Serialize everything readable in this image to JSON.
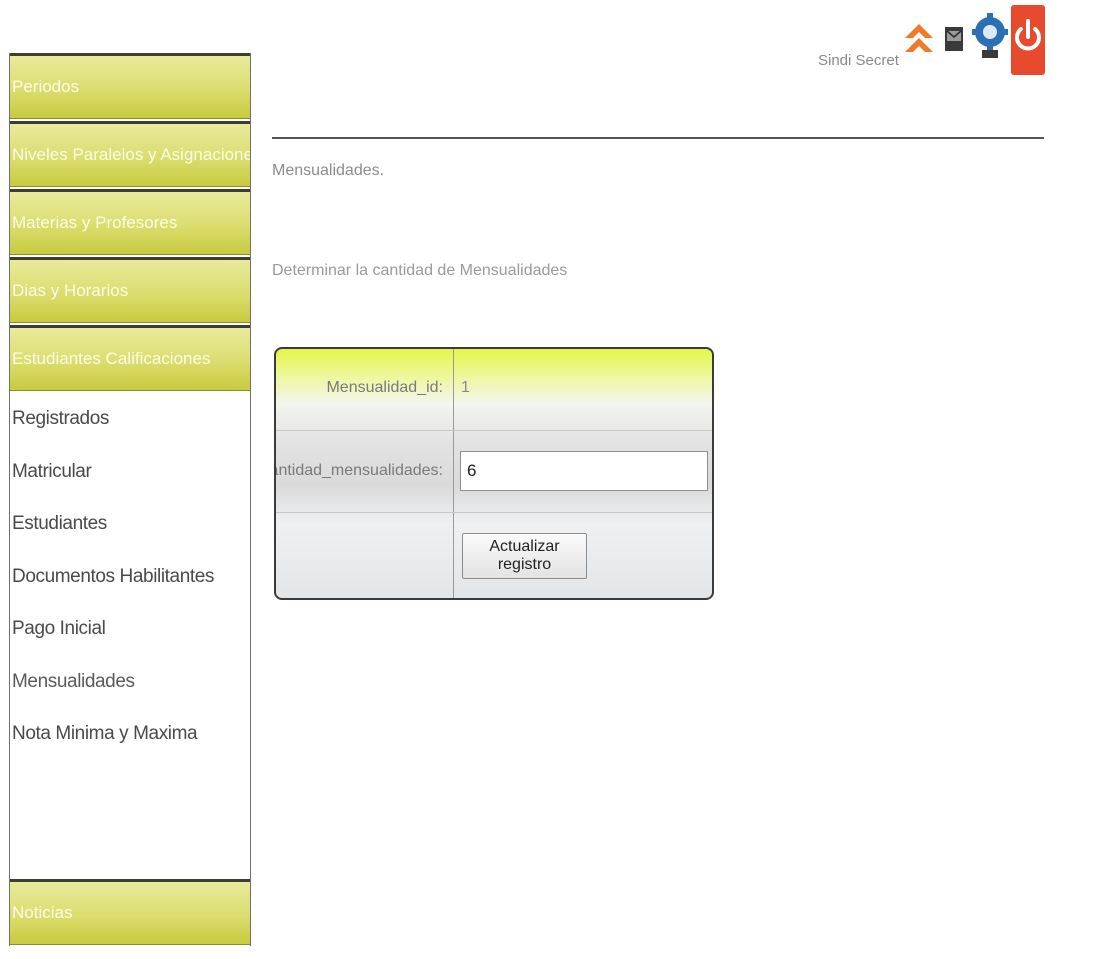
{
  "header": {
    "user_name": "Sindi Secret"
  },
  "sidebar": {
    "sections": [
      {
        "label": "Periodos"
      },
      {
        "label": "Niveles Paralelos y Asignaciones"
      },
      {
        "label": "Materias y Profesores"
      },
      {
        "label": "Dias y Horarios"
      },
      {
        "label": "Estudiantes Calificaciones"
      }
    ],
    "sub_items": [
      {
        "label": "Registrados"
      },
      {
        "label": "Matricular"
      },
      {
        "label": "Estudiantes"
      },
      {
        "label": "Documentos Habilitantes"
      },
      {
        "label": "Pago Inicial"
      },
      {
        "label": "Mensualidades"
      },
      {
        "label": "Nota Minima y Maxima"
      }
    ],
    "bottom_section": {
      "label": "Noticias"
    }
  },
  "main": {
    "title": "Mensualidades.",
    "description": "Determinar la cantidad de Mensualidades",
    "form": {
      "id_label": "Mensualidad_id:",
      "id_value": "1",
      "cantidad_label": "Cantidad_mensualidades:",
      "cantidad_value": "6",
      "submit_label": "Actualizar registro"
    }
  },
  "icons": {
    "up": "up-arrow-icon",
    "mail": "mail-icon",
    "settings": "settings-gear-icon",
    "power": "power-icon"
  },
  "colors": {
    "sidebar_accent": "#dbdd6e",
    "form_top_accent": "#e4f54a",
    "power_red": "#e84a2e",
    "up_orange": "#f07a2a",
    "gear_blue": "#2c6fb3"
  }
}
